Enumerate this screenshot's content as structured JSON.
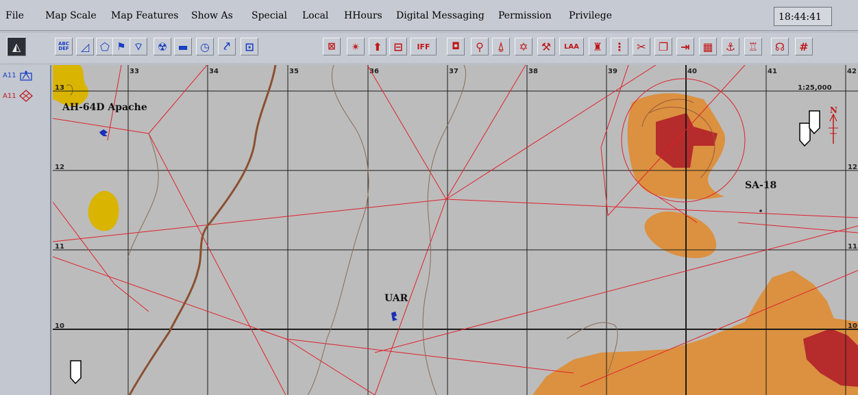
{
  "menu": [
    "File",
    "Map Scale",
    "Map Features",
    "Show As",
    "Special",
    "Local",
    "HHours",
    "Digital Messaging",
    "Permission",
    "Privilege"
  ],
  "clock": "18:44:41",
  "toolbar_left": [
    {
      "name": "abc-def-text-icon",
      "glyph": "ABC DEF"
    },
    {
      "name": "area-icon",
      "glyph": "◿"
    },
    {
      "name": "polygon-icon",
      "glyph": "⬠"
    },
    {
      "name": "flag-icon",
      "glyph": "⚑"
    },
    {
      "name": "unit-marker-icon",
      "glyph": "⌔"
    },
    {
      "name": "nuclear-icon",
      "glyph": "☢"
    },
    {
      "name": "tank-icon",
      "glyph": "▬"
    },
    {
      "name": "clock-icon",
      "glyph": "◷"
    },
    {
      "name": "route-icon",
      "glyph": "⤤"
    },
    {
      "name": "window-icon",
      "glyph": "⊡"
    }
  ],
  "toolbar_right": [
    {
      "name": "mixed-symbols-icon",
      "glyph": "⊠"
    },
    {
      "name": "obstacle-icon",
      "glyph": "✴"
    },
    {
      "name": "arrow-up-icon",
      "glyph": "⬆"
    },
    {
      "name": "radio-icon",
      "glyph": "⊟"
    },
    {
      "name": "iff-icon",
      "glyph": "IFF"
    },
    {
      "name": "camera-icon",
      "glyph": "◘"
    },
    {
      "name": "search-icon",
      "glyph": "⚲"
    },
    {
      "name": "bell-icon",
      "glyph": "⍙"
    },
    {
      "name": "star-icon",
      "glyph": "✡"
    },
    {
      "name": "hammer-icon",
      "glyph": "⚒"
    },
    {
      "name": "laa-icon",
      "glyph": "LAA"
    },
    {
      "name": "pyramid-icon",
      "glyph": "♜"
    },
    {
      "name": "dots-arrow-icon",
      "glyph": "⋮"
    },
    {
      "name": "scissors-icon",
      "glyph": "✂"
    },
    {
      "name": "copy-icon",
      "glyph": "❐"
    },
    {
      "name": "import-icon",
      "glyph": "⇥"
    },
    {
      "name": "grid-edit-icon",
      "glyph": "▦"
    },
    {
      "name": "anchor-icon",
      "glyph": "⚓"
    },
    {
      "name": "tower-icon",
      "glyph": "♖"
    },
    {
      "name": "headphones-icon",
      "glyph": "☊"
    },
    {
      "name": "hash-icon",
      "glyph": "#"
    }
  ],
  "units": [
    {
      "id": "A11",
      "color": "#1a3fc2",
      "icon": "friendly-unit-icon"
    },
    {
      "id": "A11",
      "color": "#c01818",
      "icon": "hostile-unit-icon"
    }
  ],
  "grid": {
    "columns": [
      "33",
      "34",
      "35",
      "36",
      "37",
      "38",
      "39",
      "40",
      "41",
      "42"
    ],
    "rows": [
      "13",
      "12",
      "11",
      "10"
    ],
    "scale": "1:25,000"
  },
  "map_labels": {
    "apache": "AH-64D Apache",
    "uar": "UAR",
    "sa18": "SA-18",
    "north": "N"
  }
}
